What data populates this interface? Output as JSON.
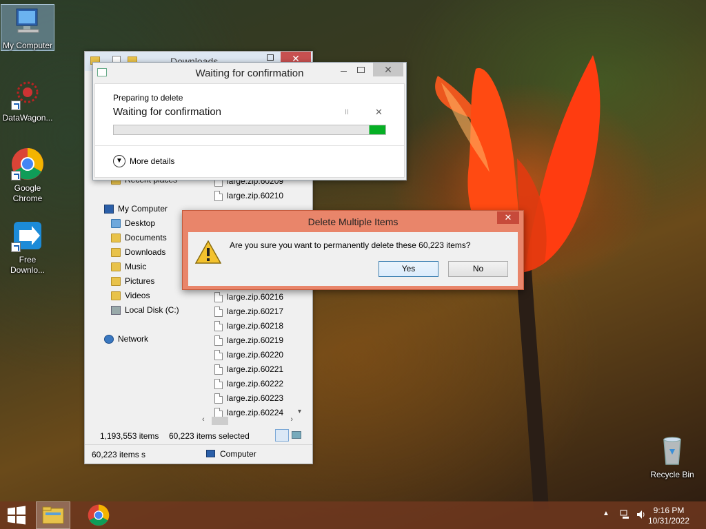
{
  "desktop": {
    "icons": [
      {
        "label": "My Computer",
        "icon": "computer-icon"
      },
      {
        "label": "DataWagon...",
        "icon": "datawagon-icon"
      },
      {
        "label": "Google Chrome",
        "icon": "chrome-icon"
      },
      {
        "label": "Free Downlo...",
        "icon": "free-download-manager-icon"
      },
      {
        "label": "Recycle Bin",
        "icon": "recycle-bin-icon"
      }
    ]
  },
  "explorer": {
    "title": "Downloads",
    "nav": {
      "recent": "Recent places",
      "my_computer": "My Computer",
      "desktop": "Desktop",
      "documents": "Documents",
      "downloads": "Downloads",
      "music": "Music",
      "pictures": "Pictures",
      "videos": "Videos",
      "local_disk": "Local Disk (C:)",
      "network": "Network"
    },
    "files": [
      "large.zip.60209",
      "large.zip.60210",
      "large.zip.60216",
      "large.zip.60217",
      "large.zip.60218",
      "large.zip.60219",
      "large.zip.60220",
      "large.zip.60221",
      "large.zip.60222",
      "large.zip.60223",
      "large.zip.60224"
    ],
    "status": {
      "item_count": "1,193,553 items",
      "selected": "60,223 items selected",
      "details_left": "60,223 items s",
      "details_right": "Computer"
    }
  },
  "progress_dialog": {
    "title": "Waiting for confirmation",
    "subtitle": "Preparing to delete",
    "heading": "Waiting for confirmation",
    "pause_symbol": "II",
    "cancel_symbol": "✕",
    "progress": 0.94,
    "progress_color": "#06b025",
    "more_details": "More details"
  },
  "confirm_dialog": {
    "title": "Delete Multiple Items",
    "message": "Are you sure you want to permanently delete these 60,223 items?",
    "yes": "Yes",
    "no": "No",
    "close_symbol": "✕"
  },
  "taskbar": {
    "time": "9:16 PM",
    "date": "10/31/2022"
  }
}
